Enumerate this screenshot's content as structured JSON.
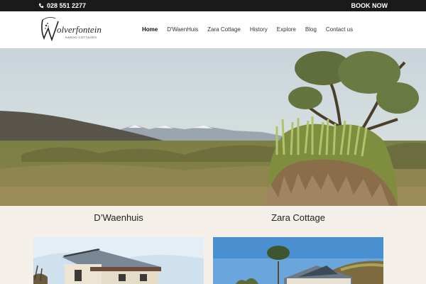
{
  "topbar": {
    "phone": "028 551 2277",
    "book_now": "BOOK NOW"
  },
  "logo": {
    "name": "olverfontein",
    "tagline": "KAROO COTTAGES"
  },
  "nav": {
    "items": [
      {
        "label": "Home",
        "active": true
      },
      {
        "label": "D'WaenHuis"
      },
      {
        "label": "Zara Cottage"
      },
      {
        "label": "History"
      },
      {
        "label": "Explore"
      },
      {
        "label": "Blog"
      },
      {
        "label": "Contact us"
      }
    ]
  },
  "cottages": [
    {
      "title": "D’Waenhuis"
    },
    {
      "title": "Zara Cottage"
    }
  ],
  "colors": {
    "topbar": "#1a1a1a",
    "background": "#f4efe9"
  },
  "icons": {
    "phone": "phone-icon"
  }
}
